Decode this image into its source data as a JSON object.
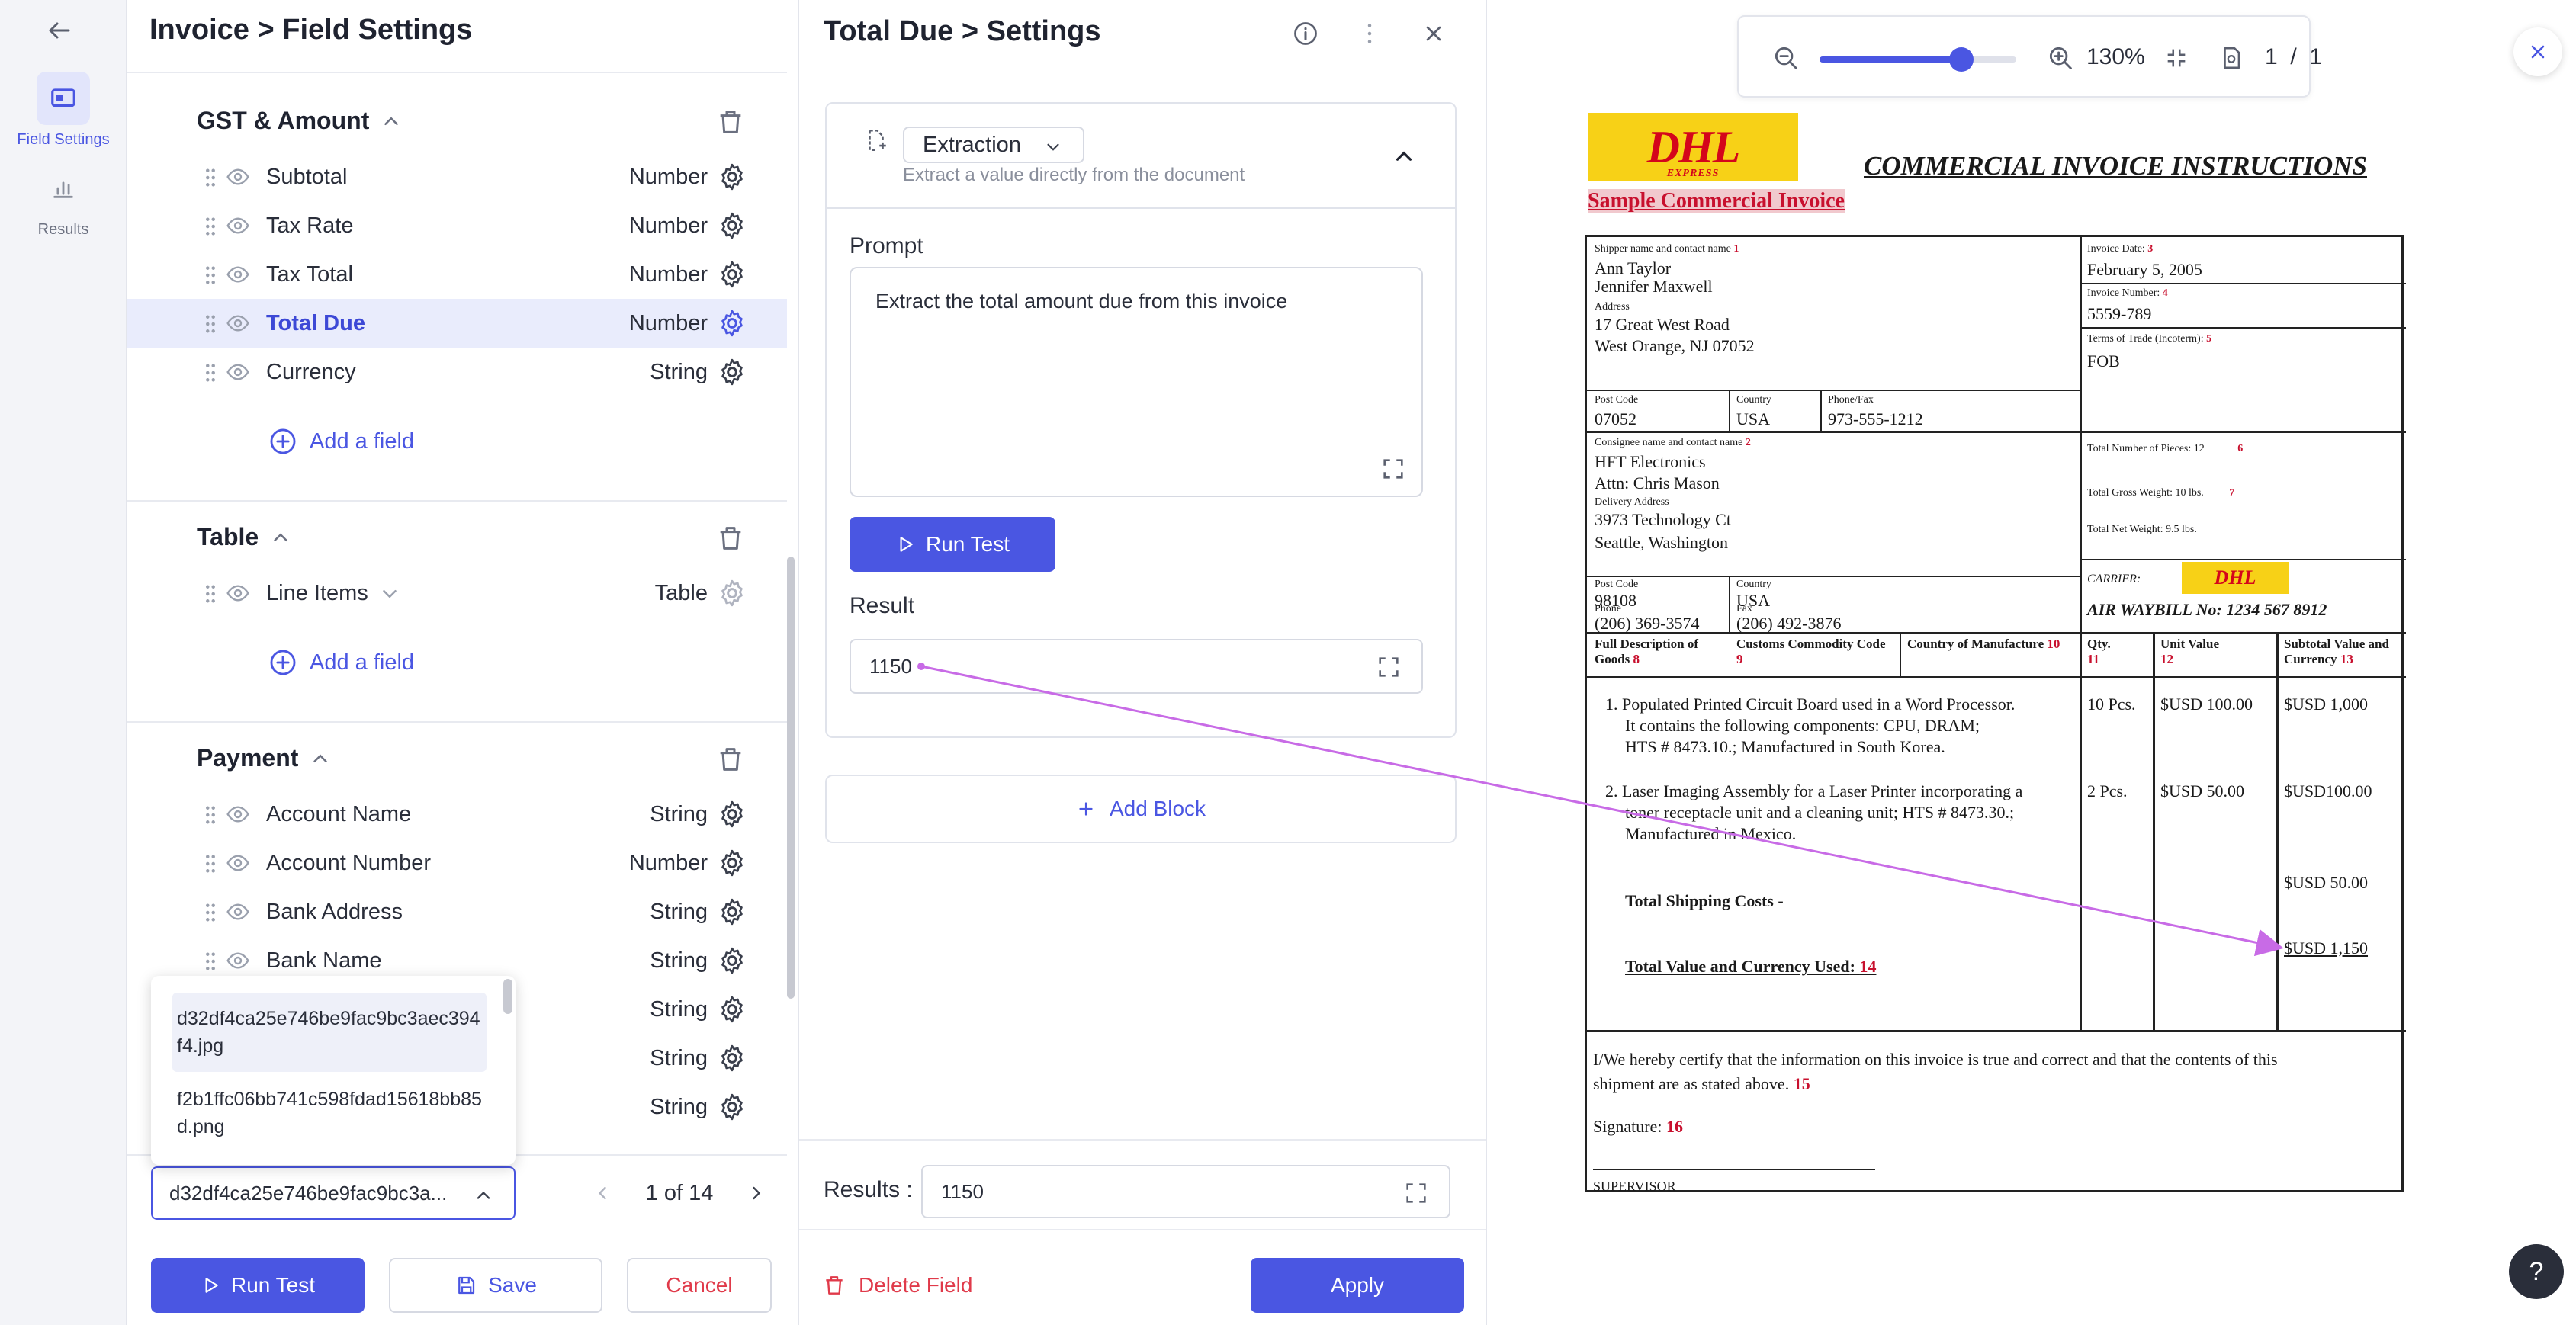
{
  "rail": {
    "items": [
      {
        "label": "Field Settings",
        "icon": "field-settings-icon",
        "active": true
      },
      {
        "label": "Results",
        "icon": "results-chart-icon",
        "active": false
      }
    ]
  },
  "field_panel": {
    "breadcrumb": "Invoice > Field Settings",
    "sections": [
      {
        "title": "GST & Amount",
        "fields": [
          {
            "name": "Subtotal",
            "type": "Number"
          },
          {
            "name": "Tax Rate",
            "type": "Number"
          },
          {
            "name": "Tax Total",
            "type": "Number"
          },
          {
            "name": "Total Due",
            "type": "Number",
            "selected": true
          },
          {
            "name": "Currency",
            "type": "String"
          }
        ],
        "add_label": "Add a field"
      },
      {
        "title": "Table",
        "fields": [
          {
            "name": "Line Items",
            "type": "Table"
          }
        ],
        "add_label": "Add a field"
      },
      {
        "title": "Payment",
        "fields": [
          {
            "name": "Account Name",
            "type": "String"
          },
          {
            "name": "Account Number",
            "type": "Number"
          },
          {
            "name": "Bank Address",
            "type": "String"
          },
          {
            "name": "Bank Name",
            "type": "String"
          },
          {
            "name": "",
            "type": "String"
          },
          {
            "name": "",
            "type": "String"
          },
          {
            "name": "",
            "type": "String"
          }
        ]
      }
    ],
    "file_dropdown": {
      "options": [
        "d32df4ca25e746be9fac9bc3aec394f4.jpg",
        "f2b1ffc06bb741c598fdad15618bb85d.png"
      ],
      "selected_display": "d32df4ca25e746be9fac9bc3a..."
    },
    "pager": {
      "text": "1 of 14"
    },
    "buttons": {
      "run_test": "Run Test",
      "save": "Save",
      "cancel": "Cancel"
    }
  },
  "settings_panel": {
    "title": "Total Due > Settings",
    "block": {
      "type": "Extraction",
      "type_description": "Extract a value directly from the document",
      "prompt_label": "Prompt",
      "prompt_value": "Extract the total amount due from this invoice",
      "run_test": "Run Test",
      "result_label": "Result",
      "result_value": "1150"
    },
    "add_block": "Add Block",
    "results_label": "Results :",
    "results_value": "1150",
    "delete_field": "Delete Field",
    "apply": "Apply"
  },
  "viewer": {
    "zoom": "130%",
    "zoom_level": 0.72,
    "page_current": "1",
    "page_sep": "/",
    "page_total": "1",
    "help": "?"
  },
  "document": {
    "logo_text": "DHL",
    "logo_sub": "EXPRESS",
    "title": "COMMERCIAL INVOICE INSTRUCTIONS",
    "subtitle": "Sample Commercial Invoice",
    "shipper_label": "Shipper name and contact name",
    "shipper_num": "1",
    "shipper_lines": [
      "Ann Taylor",
      "Jennifer Maxwell"
    ],
    "address_label": "Address",
    "address_lines": [
      "17 Great West Road",
      "West Orange, NJ 07052"
    ],
    "post_code_label": "Post Code",
    "post_code": "07052",
    "country_label": "Country",
    "country": "USA",
    "phone_fax_label": "Phone/Fax",
    "phone_fax": "973-555-1212",
    "invoice_date_label": "Invoice Date:",
    "invoice_date_num": "3",
    "invoice_date": "February 5, 2005",
    "invoice_number_label": "Invoice Number:",
    "invoice_number_num": "4",
    "invoice_number": "5559-789",
    "terms_label": "Terms of Trade (Incoterm):",
    "terms_num": "5",
    "terms": "FOB",
    "consignee_label": "Consignee name and contact name",
    "consignee_num": "2",
    "consignee_lines": [
      "HFT Electronics",
      "Attn: Chris Mason"
    ],
    "delivery_label": "Delivery Address",
    "delivery_lines": [
      "3973 Technology Ct",
      "Seattle, Washington"
    ],
    "post_code2": "98108",
    "country2": "USA",
    "phone_label": "Phone",
    "phone": "(206) 369-3574",
    "fax_label": "Fax",
    "fax": "(206) 492-3876",
    "pieces": "Total Number of Pieces: 12",
    "pieces_num": "6",
    "gross_weight": "Total Gross Weight: 10 lbs.",
    "gross_num": "7",
    "net_weight": "Total Net Weight: 9.5 lbs.",
    "carrier_label": "CARRIER:",
    "waybill": "AIR WAYBILL No: 1234 567 8912",
    "col_desc": "Full Description of Goods",
    "col_desc_num": "8",
    "col_code": "Customs Commodity Code",
    "col_code_num": "9",
    "col_country": "Country of Manufacture",
    "col_country_num": "10",
    "col_qty": "Qty.",
    "col_qty_num": "11",
    "col_unit": "Unit Value",
    "col_unit_num": "12",
    "col_sub": "Subtotal Value and Currency",
    "col_sub_num": "13",
    "item1": [
      "1.  Populated Printed Circuit Board used in a Word Processor.",
      "It contains the following components: CPU, DRAM;",
      "HTS # 8473.10.; Manufactured in South Korea."
    ],
    "item1_qty": "10 Pcs.",
    "item1_unit": "$USD 100.00",
    "item1_sub": "$USD 1,000",
    "item2": [
      "2.  Laser Imaging Assembly for a Laser Printer incorporating a",
      "toner receptacle unit and a cleaning unit; HTS # 8473.30.;",
      "Manufactured in Mexico."
    ],
    "item2_qty": "2 Pcs.",
    "item2_unit": "$USD 50.00",
    "item2_sub": "$USD100.00",
    "shipping_label": "Total Shipping Costs -",
    "shipping_value": "$USD 50.00",
    "total_label": "Total Value and Currency Used",
    "total_num": "14",
    "total_value": "$USD 1,150",
    "certify": [
      "I/We hereby certify that the information on this invoice is true and correct and that the contents of this",
      "shipment are as stated above."
    ],
    "certify_num": "15",
    "signature_label": "Signature:",
    "signature_num": "16",
    "supervisor": "SUPERVISOR"
  },
  "colors": {
    "accent": "#4a56e2",
    "danger": "#e03a4a",
    "arrow": "#c86be6",
    "dhl_yellow": "#f7d117",
    "dhl_red": "#d4051b"
  }
}
